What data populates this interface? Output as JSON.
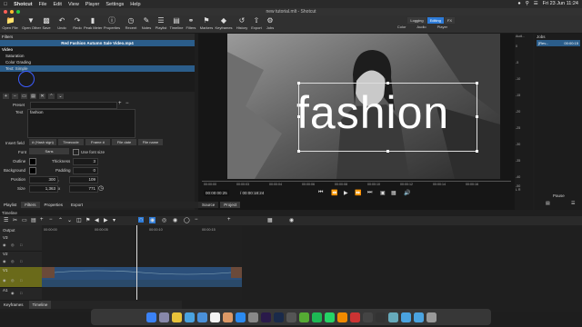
{
  "menubar": {
    "app": "Shotcut",
    "items": [
      "File",
      "Edit",
      "View",
      "Player",
      "Settings",
      "Help"
    ],
    "datetime": "Fri 23 Jun 11:24"
  },
  "window": {
    "title": "new tutorial.mlt - Shotcut"
  },
  "toolbar": {
    "buttons": [
      {
        "label": "Open File",
        "icon": "folder-icon"
      },
      {
        "label": "Open Other",
        "icon": "open-other-icon"
      },
      {
        "label": "Save",
        "icon": "save-icon"
      },
      {
        "label": "Undo",
        "icon": "undo-icon"
      },
      {
        "label": "Redo",
        "icon": "redo-icon"
      },
      {
        "label": "Peak Meter",
        "icon": "peak-meter-icon"
      },
      {
        "label": "Properties",
        "icon": "properties-icon"
      },
      {
        "label": "Recent",
        "icon": "recent-icon"
      },
      {
        "label": "Notes",
        "icon": "notes-icon"
      },
      {
        "label": "Playlist",
        "icon": "playlist-icon"
      },
      {
        "label": "Timeline",
        "icon": "timeline-icon"
      },
      {
        "label": "Filters",
        "icon": "filters-icon"
      },
      {
        "label": "Markers",
        "icon": "markers-icon"
      },
      {
        "label": "Keyframes",
        "icon": "keyframes-icon"
      },
      {
        "label": "History",
        "icon": "history-icon"
      },
      {
        "label": "Export",
        "icon": "export-icon"
      },
      {
        "label": "Jobs",
        "icon": "jobs-icon"
      }
    ],
    "layouts": [
      "Logging",
      "Editing",
      "FX"
    ],
    "layouts_active": "Editing",
    "layouts_row2": [
      "Color",
      "Audio",
      "Player"
    ]
  },
  "filters_panel": {
    "title": "Filters",
    "clip_name": "Red Fashion Autumn Sale Video.mp4",
    "section": "Video",
    "items": [
      "Saturation",
      "Color Grading",
      "Text: Simple"
    ],
    "selected_index": 2,
    "preset_label": "Preset",
    "text_label": "Text",
    "text_value": "fashion",
    "insert_field_label": "Insert field",
    "insert_buttons": [
      "# (Hash sign)",
      "Timecode",
      "Frame #",
      "File date",
      "File name"
    ],
    "font_label": "Font",
    "font_value": "Sans",
    "use_font_size_label": "Use font size",
    "outline_label": "Outline",
    "thickness_label": "Thickness",
    "thickness_value": "3",
    "background_label": "Background",
    "padding_label": "Padding",
    "padding_value": "0",
    "position_label": "Position",
    "position_x": "300",
    "position_y": "109",
    "size_label": "Size",
    "size_w": "1,363",
    "size_h": "771",
    "outline_color": "#000000",
    "background_color": "#000000"
  },
  "viewer": {
    "overlay_text": "fashion",
    "ruler_ticks": [
      "00:00:00",
      "00:00:03",
      "00:00:04",
      "00:00:06",
      "00:00:08",
      "00:00:10",
      "00:00:12",
      "00:00:14",
      "00:00:16"
    ],
    "timecode_current": "00:00:00:25",
    "timecode_total": "/ 00:00:18:24",
    "tabs": [
      "Source",
      "Project"
    ],
    "active_tab": "Project"
  },
  "audio": {
    "title": "Audi...",
    "ticks": [
      "0",
      "-5",
      "-10",
      "-15",
      "-20",
      "-25",
      "-30",
      "-35",
      "-40",
      "-50"
    ],
    "lr": "L  R"
  },
  "jobs": {
    "title": "Jobs",
    "job_name": "[Rev...",
    "job_time": "00:00:15",
    "pause_label": "Pause"
  },
  "bottom_tabs": {
    "items": [
      "Playlist",
      "Filters",
      "Properties",
      "Export"
    ],
    "active": "Filters"
  },
  "timeline": {
    "title": "Timeline",
    "header": "Output",
    "tracks": [
      "V3",
      "V2",
      "V1",
      "A1"
    ],
    "ruler": [
      "00:00:00",
      "00:00:05",
      "00:00:10",
      "00:00:15"
    ],
    "bottom_tabs": [
      "Keyframes",
      "Timeline"
    ],
    "bottom_active": "Timeline"
  },
  "colors": {
    "selection": "#2b5d8a",
    "accent": "#2d7bd8",
    "clip": "#2b4f7a",
    "track_highlight": "#6a6a1a"
  }
}
